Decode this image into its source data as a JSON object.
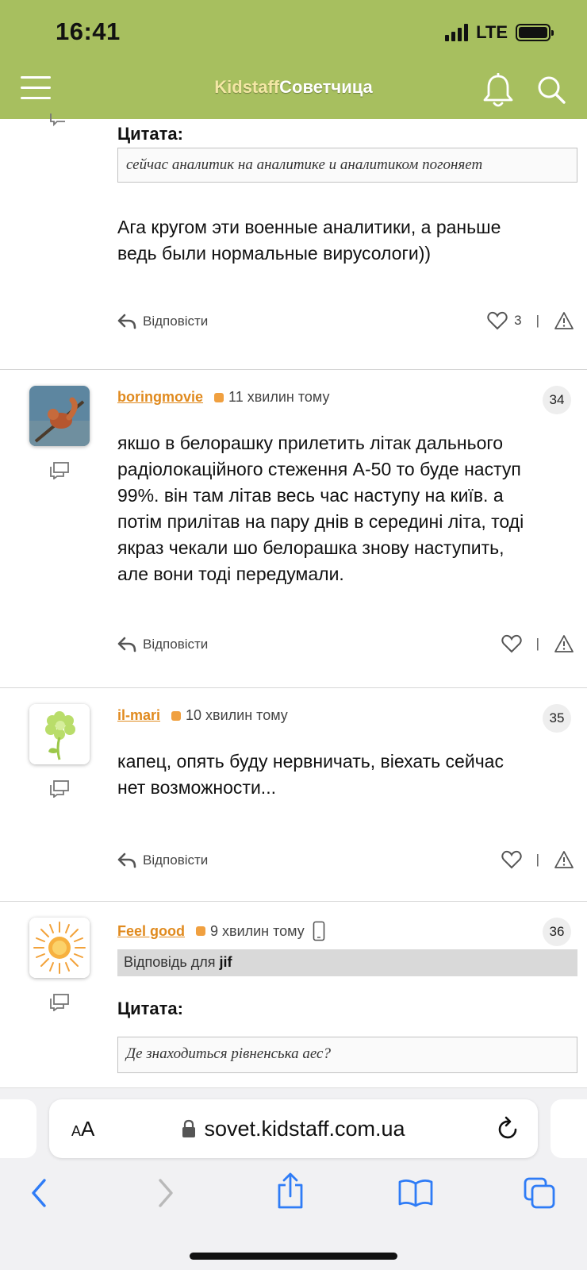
{
  "status_bar": {
    "time": "16:41",
    "network": "LTE"
  },
  "header": {
    "title_part1": "Kidstaff",
    "title_part2": "Советчица"
  },
  "colors": {
    "header_bg": "#a7bf5f",
    "author": "#e08a1e",
    "status_dot": "#f0a040"
  },
  "posts": [
    {
      "quote_label": "Цитата:",
      "quote": "сейчас аналитик на аналитике и аналитиком погоняет",
      "text_lines": [
        "Ага кругом эти военные аналитики, а раньше",
        "ведь были нормальные вирусологи))"
      ],
      "reply_label": "Відповісти",
      "likes": "3"
    },
    {
      "author": "boringmovie",
      "time": "11 хвилин тому",
      "number": "34",
      "text_lines": [
        "якшо в белорашку прилетить літак дальнього",
        "радіолокаційного стеження А-50 то буде наступ",
        "99%. він там літав весь час наступу на київ. а",
        "потім прилітав на пару днів в середині літа, тоді",
        "якраз чекали шо белорашка знову наступить,",
        "але вони тоді передумали."
      ],
      "reply_label": "Відповісти"
    },
    {
      "author": "il-mari",
      "time": "10 хвилин тому",
      "number": "35",
      "text_lines": [
        "капец, опять буду нервничать, віехать сейчас",
        "нет возможности..."
      ],
      "reply_label": "Відповісти"
    },
    {
      "author": "Feel good",
      "time": "9 хвилин тому",
      "number": "36",
      "reply_to_prefix": "Відповідь для",
      "reply_to_user": "jif",
      "quote_label": "Цитата:",
      "quote": "Де знаходиться рівненська аес?"
    }
  ],
  "separator": "|",
  "browser": {
    "aa_small": "A",
    "aa_large": "A",
    "url": "sovet.kidstaff.com.ua"
  }
}
